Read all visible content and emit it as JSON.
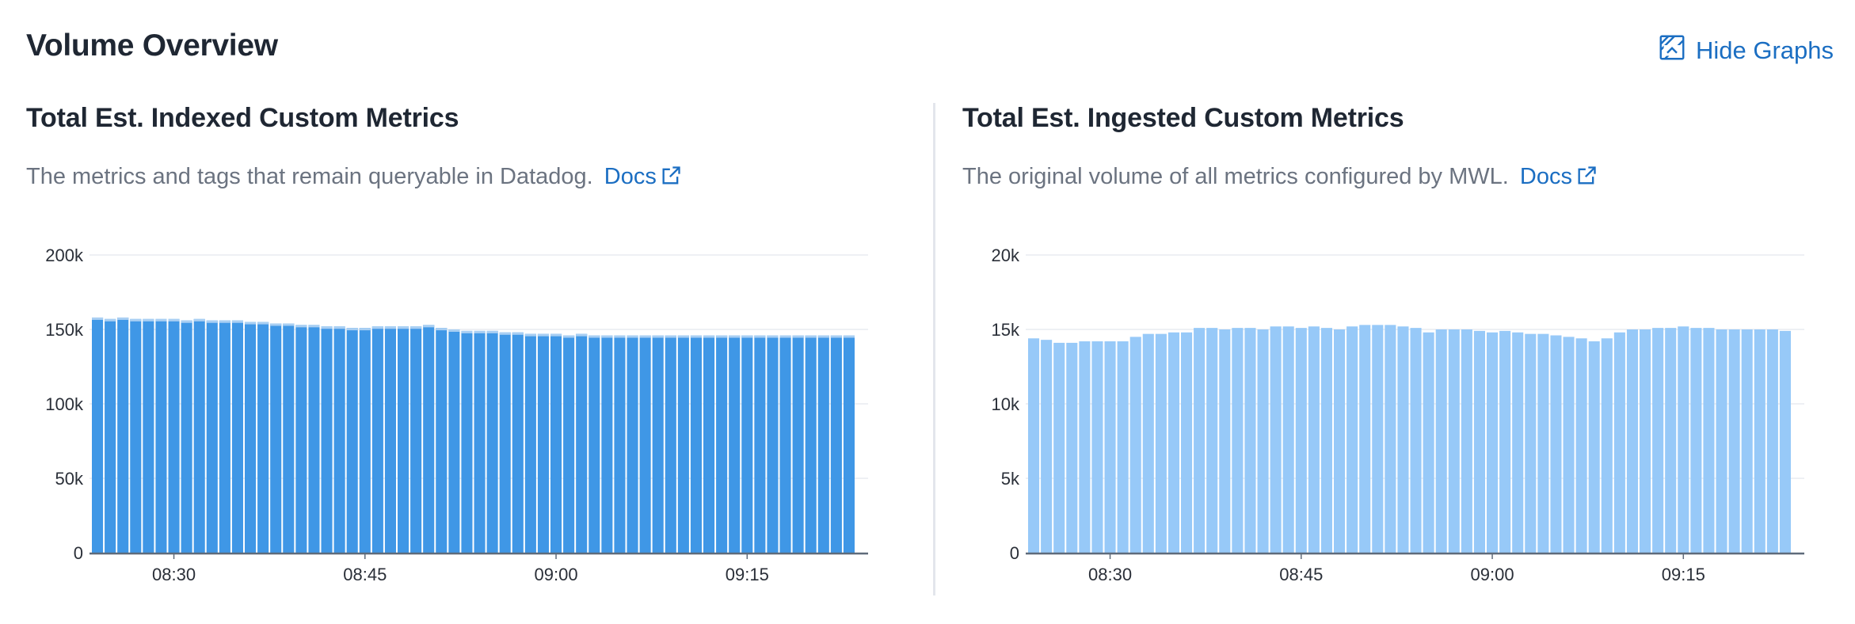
{
  "header": {
    "title": "Volume Overview",
    "hide_graphs_label": "Hide Graphs"
  },
  "panels": [
    {
      "title": "Total Est. Indexed Custom Metrics",
      "description": "The metrics and tags that remain queryable in Datadog.",
      "docs_label": "Docs"
    },
    {
      "title": "Total Est. Ingested Custom Metrics",
      "description": "The original volume of all metrics configured by MWL.",
      "docs_label": "Docs"
    }
  ],
  "colors": {
    "accent_link": "#1b6ec2",
    "indexed_bar": "#3f97e6",
    "indexed_bar_top": "#a9cff3",
    "ingested_bar": "#97c9f8",
    "grid": "#e9ecf0",
    "axis": "#5f6b7a"
  },
  "chart_data": [
    {
      "type": "bar",
      "title": "Total Est. Indexed Custom Metrics",
      "xlabel": "",
      "ylabel": "",
      "ylim": [
        0,
        200000
      ],
      "y_ticks": [
        0,
        50000,
        100000,
        150000,
        200000
      ],
      "y_tick_labels": [
        "0",
        "50k",
        "100k",
        "150k",
        "200k"
      ],
      "x_tick_labels": [
        "08:30",
        "08:45",
        "09:00",
        "09:15"
      ],
      "x_tick_indices": [
        6,
        21,
        36,
        51
      ],
      "grid": true,
      "values": [
        158000,
        157000,
        158000,
        157000,
        157000,
        157000,
        157000,
        156000,
        157000,
        156000,
        156000,
        156000,
        155000,
        155000,
        154000,
        154000,
        153000,
        153000,
        152000,
        152000,
        151000,
        151000,
        152000,
        152000,
        152000,
        152000,
        153000,
        151000,
        150000,
        149000,
        149000,
        149000,
        148000,
        148000,
        147000,
        147000,
        147000,
        146000,
        147000,
        146000,
        146000,
        146000,
        146000,
        146000,
        146000,
        146000,
        146000,
        146000,
        146000,
        146000,
        146000,
        146000,
        146000,
        146000,
        146000,
        146000,
        146000,
        146000,
        146000,
        146000
      ]
    },
    {
      "type": "bar",
      "title": "Total Est. Ingested Custom Metrics",
      "xlabel": "",
      "ylabel": "",
      "ylim": [
        0,
        20000
      ],
      "y_ticks": [
        0,
        5000,
        10000,
        15000,
        20000
      ],
      "y_tick_labels": [
        "0",
        "5k",
        "10k",
        "15k",
        "20k"
      ],
      "x_tick_labels": [
        "08:30",
        "08:45",
        "09:00",
        "09:15"
      ],
      "x_tick_indices": [
        6,
        21,
        36,
        51
      ],
      "grid": true,
      "values": [
        14400,
        14300,
        14100,
        14100,
        14200,
        14200,
        14200,
        14200,
        14500,
        14700,
        14700,
        14800,
        14800,
        15100,
        15100,
        15000,
        15100,
        15100,
        15000,
        15200,
        15200,
        15100,
        15200,
        15100,
        15000,
        15200,
        15300,
        15300,
        15300,
        15200,
        15100,
        14800,
        15000,
        15000,
        15000,
        14900,
        14800,
        14900,
        14800,
        14700,
        14700,
        14600,
        14500,
        14400,
        14200,
        14400,
        14800,
        15000,
        15000,
        15100,
        15100,
        15200,
        15100,
        15100,
        15000,
        15000,
        15000,
        15000,
        15000,
        14900
      ]
    }
  ]
}
